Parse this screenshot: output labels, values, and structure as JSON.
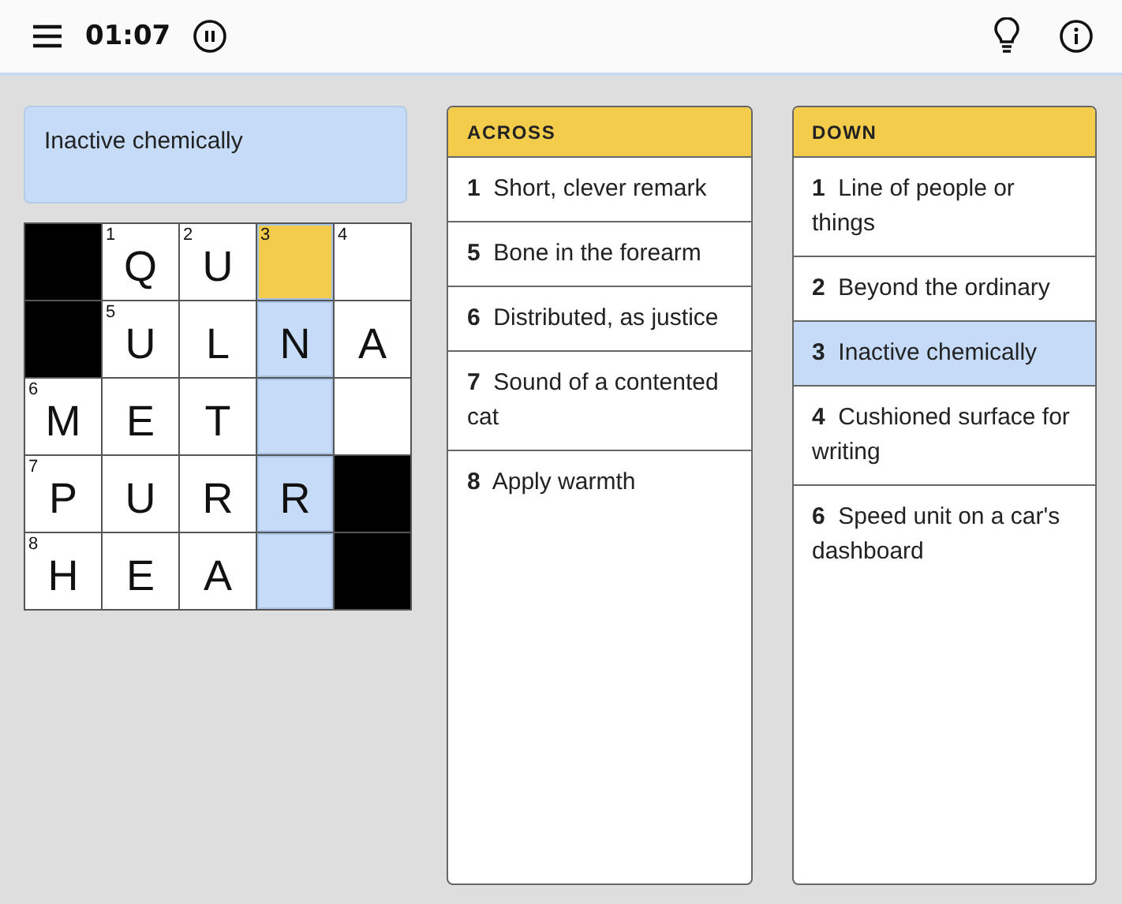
{
  "header": {
    "timer": "01:07"
  },
  "current_clue": {
    "text": "Inactive chemically"
  },
  "grid": {
    "rows": [
      [
        {
          "kind": "block"
        },
        {
          "kind": "cell",
          "number": "1",
          "letter": "Q",
          "selected": false,
          "highlighted": false
        },
        {
          "kind": "cell",
          "number": "2",
          "letter": "U",
          "selected": false,
          "highlighted": false
        },
        {
          "kind": "cell",
          "number": "3",
          "selected": true,
          "highlighted": true
        },
        {
          "kind": "cell",
          "number": "4",
          "selected": false,
          "highlighted": false
        }
      ],
      [
        {
          "kind": "block"
        },
        {
          "kind": "cell",
          "number": "5",
          "letter": "U",
          "selected": false,
          "highlighted": false
        },
        {
          "kind": "cell",
          "letter": "L",
          "selected": false,
          "highlighted": false
        },
        {
          "kind": "cell",
          "letter": "N",
          "selected": false,
          "highlighted": true
        },
        {
          "kind": "cell",
          "letter": "A",
          "selected": false,
          "highlighted": false
        }
      ],
      [
        {
          "kind": "cell",
          "number": "6",
          "letter": "M",
          "selected": false,
          "highlighted": false
        },
        {
          "kind": "cell",
          "letter": "E",
          "selected": false,
          "highlighted": false
        },
        {
          "kind": "cell",
          "letter": "T",
          "selected": false,
          "highlighted": false
        },
        {
          "kind": "cell",
          "selected": false,
          "highlighted": true
        },
        {
          "kind": "cell",
          "selected": false,
          "highlighted": false
        }
      ],
      [
        {
          "kind": "cell",
          "number": "7",
          "letter": "P",
          "selected": false,
          "highlighted": false
        },
        {
          "kind": "cell",
          "letter": "U",
          "selected": false,
          "highlighted": false
        },
        {
          "kind": "cell",
          "letter": "R",
          "selected": false,
          "highlighted": false
        },
        {
          "kind": "cell",
          "letter": "R",
          "selected": false,
          "highlighted": true
        },
        {
          "kind": "block"
        }
      ],
      [
        {
          "kind": "cell",
          "number": "8",
          "letter": "H",
          "selected": false,
          "highlighted": false
        },
        {
          "kind": "cell",
          "letter": "E",
          "selected": false,
          "highlighted": false
        },
        {
          "kind": "cell",
          "letter": "A",
          "selected": false,
          "highlighted": false
        },
        {
          "kind": "cell",
          "selected": false,
          "highlighted": true
        },
        {
          "kind": "block"
        }
      ]
    ]
  },
  "clue_lists": [
    {
      "heading": "ACROSS",
      "clues": [
        {
          "number": "1",
          "text": "Short, clever remark",
          "selected": false
        },
        {
          "number": "5",
          "text": "Bone in the forearm",
          "selected": false
        },
        {
          "number": "6",
          "text": "Distributed, as justice",
          "selected": false
        },
        {
          "number": "7",
          "text": "Sound of a contented cat",
          "selected": false
        },
        {
          "number": "8",
          "text": "Apply warmth",
          "selected": false
        }
      ]
    },
    {
      "heading": "DOWN",
      "clues": [
        {
          "number": "1",
          "text": "Line of people or things",
          "selected": false
        },
        {
          "number": "2",
          "text": "Beyond the ordinary",
          "selected": false
        },
        {
          "number": "3",
          "text": "Inactive chemically",
          "selected": true
        },
        {
          "number": "4",
          "text": "Cushioned surface for writing",
          "selected": false
        },
        {
          "number": "6",
          "text": "Speed unit on a car's dashboard",
          "selected": false
        }
      ]
    }
  ]
}
